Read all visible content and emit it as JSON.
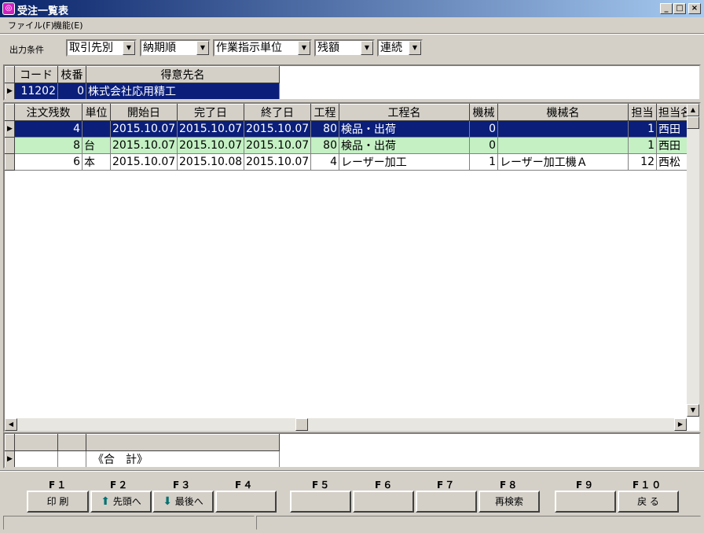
{
  "window": {
    "title": "受注一覧表",
    "app_icon": "app-icon",
    "controls": [
      "_",
      "□",
      "×"
    ]
  },
  "menu": {
    "items": [
      "ファイル(F)",
      "機能(E)"
    ]
  },
  "conditions": {
    "label": "出力条件",
    "combos": [
      "取引先別",
      "納期順",
      "作業指示単位",
      "残額",
      "連続"
    ]
  },
  "customer_grid": {
    "headers": [
      "コード",
      "枝番",
      "得意先名"
    ],
    "rows": [
      {
        "code": "11202",
        "branch": "0",
        "name": "株式会社応用精工"
      }
    ]
  },
  "order_grid": {
    "headers": [
      "注文残数",
      "単位",
      "開始日",
      "完了日",
      "終了日",
      "工程",
      "工程名",
      "機械",
      "機械名",
      "担当",
      "担当名"
    ],
    "rows": [
      [
        "4",
        "",
        "2015.10.07",
        "2015.10.07",
        "2015.10.07",
        "80",
        "検品・出荷",
        "0",
        "",
        "1",
        "西田"
      ],
      [
        "8",
        "台",
        "2015.10.07",
        "2015.10.07",
        "2015.10.07",
        "80",
        "検品・出荷",
        "0",
        "",
        "1",
        "西田"
      ],
      [
        "6",
        "本",
        "2015.10.07",
        "2015.10.08",
        "2015.10.07",
        "4",
        "レーザー加工",
        "1",
        "レーザー加工機Ａ",
        "12",
        "西松"
      ]
    ]
  },
  "total_grid": {
    "total_label": "《合　計》"
  },
  "function_keys": [
    {
      "key": "F１",
      "label": "印 刷",
      "icon": ""
    },
    {
      "key": "F２",
      "label": "先頭へ",
      "icon": "up-arrow-icon"
    },
    {
      "key": "F３",
      "label": "最後へ",
      "icon": "down-arrow-icon"
    },
    {
      "key": "F４",
      "label": "",
      "icon": ""
    },
    {
      "key": "F５",
      "label": "",
      "icon": ""
    },
    {
      "key": "F６",
      "label": "",
      "icon": ""
    },
    {
      "key": "F７",
      "label": "",
      "icon": ""
    },
    {
      "key": "F８",
      "label": "再検索",
      "icon": ""
    },
    {
      "key": "F９",
      "label": "",
      "icon": ""
    },
    {
      "key": "F１０",
      "label": "戻 る",
      "icon": ""
    }
  ],
  "colors": {
    "selected_row": "#0a1e7a",
    "green_row": "#c4f0c4",
    "title_bar": "#0a246a",
    "arrow_icon": "#007070"
  }
}
